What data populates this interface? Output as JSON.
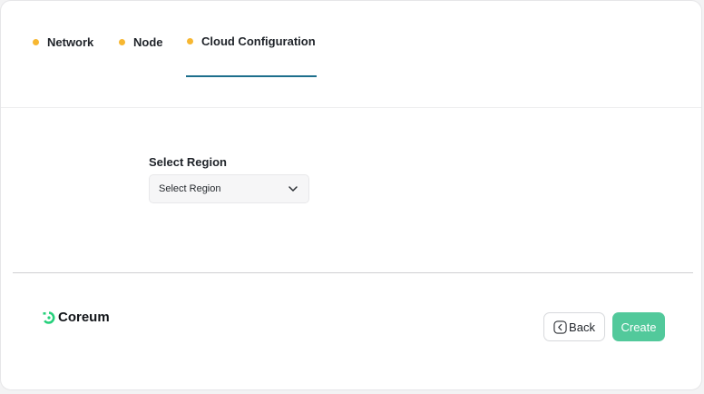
{
  "steps": [
    {
      "label": "Network"
    },
    {
      "label": "Node"
    },
    {
      "label": "Cloud Configuration"
    }
  ],
  "active_step": "Cloud Configuration",
  "colors": {
    "step_dot": "#f7b731",
    "active_underline": "#1d6f8c",
    "create_button": "#52c99b",
    "brand_logo": "#25d07a"
  },
  "region": {
    "label": "Select Region",
    "selected_value": "Select Region"
  },
  "brand": {
    "name": "Coreum"
  },
  "footer": {
    "back_label": "Back",
    "create_label": "Create"
  }
}
